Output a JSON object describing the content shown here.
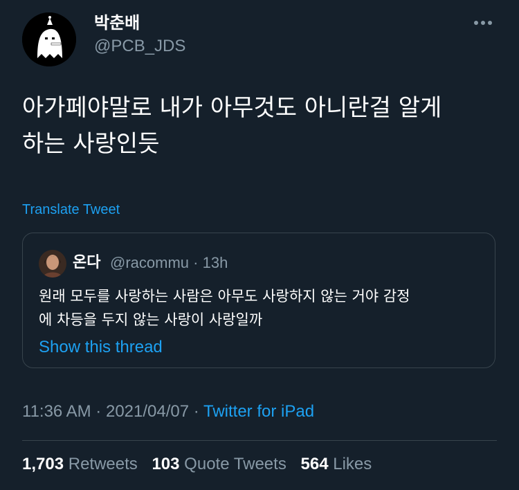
{
  "author": {
    "display_name": "박춘배",
    "handle": "@PCB_JDS",
    "avatar_icon": "ghost-character-avatar-icon"
  },
  "more_icon": "more-options-icon",
  "tweet": {
    "line1": "아가페야말로 내가 아무것도 아니란걸 알게",
    "line2": "하는 사랑인듯",
    "translate_label": "Translate Tweet"
  },
  "quoted": {
    "display_name": "온다",
    "handle": "@racommu",
    "separator": "·",
    "time": "13h",
    "text_line1": "원래 모두를 사랑하는 사람은 아무도 사랑하지 않는 거야 감정",
    "text_line2": "에 차등을 두지 않는 사랑이 사랑일까",
    "show_thread": "Show this thread"
  },
  "meta": {
    "time": "11:36 AM",
    "sep1": "·",
    "date": "2021/04/07",
    "sep2": "·",
    "source": "Twitter for iPad"
  },
  "stats": {
    "retweets_count": "1,703",
    "retweets_label": "Retweets",
    "quotes_count": "103",
    "quotes_label": "Quote Tweets",
    "likes_count": "564",
    "likes_label": "Likes"
  },
  "colors": {
    "background": "#15202b",
    "accent": "#1da1f2",
    "secondary_text": "#8899a6",
    "border": "#38444d"
  }
}
